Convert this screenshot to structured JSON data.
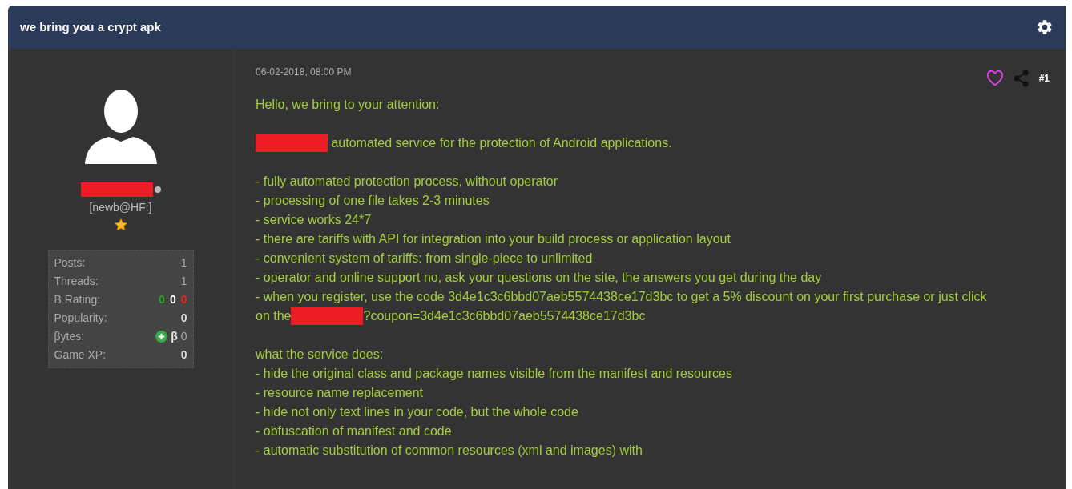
{
  "thread": {
    "title": "we bring you a crypt apk"
  },
  "author": {
    "online": false,
    "group": "[newb@HF:]",
    "stats": [
      {
        "kind": "plain",
        "label": "Posts:",
        "value": "1"
      },
      {
        "kind": "plain",
        "label": "Threads:",
        "value": "1"
      },
      {
        "kind": "rating",
        "label": "B Rating:",
        "values": [
          {
            "text": "0",
            "color": "#22aa22"
          },
          {
            "text": "0",
            "color": "#ffffff"
          },
          {
            "text": "0",
            "color": "#ee2222"
          }
        ]
      },
      {
        "kind": "bold",
        "label": "Popularity:",
        "value": "0"
      },
      {
        "kind": "bytes",
        "label": "βytes:",
        "symbol": "β",
        "value": "0"
      },
      {
        "kind": "bold",
        "label": "Game XP:",
        "value": "0"
      }
    ]
  },
  "post": {
    "date": "06-02-2018, 08:00 PM",
    "liked": false,
    "number": "#1",
    "blocks": [
      [
        {
          "parts": [
            {
              "kind": "text",
              "text": "Hello, we bring to your attention:"
            }
          ]
        }
      ],
      [
        {
          "parts": [
            {
              "kind": "redaction"
            },
            {
              "kind": "text",
              "text": " automated service for the protection of Android applications."
            }
          ]
        }
      ],
      [
        {
          "parts": [
            {
              "kind": "text",
              "text": "- fully automated protection process, without operator"
            }
          ]
        },
        {
          "parts": [
            {
              "kind": "text",
              "text": "- processing of one file takes 2-3 minutes"
            }
          ]
        },
        {
          "parts": [
            {
              "kind": "text",
              "text": "- service works 24*7"
            }
          ]
        },
        {
          "parts": [
            {
              "kind": "text",
              "text": "- there are tariffs with API for integration into your build process or application layout"
            }
          ]
        },
        {
          "parts": [
            {
              "kind": "text",
              "text": "- convenient system of tariffs: from single-piece to unlimited"
            }
          ]
        },
        {
          "parts": [
            {
              "kind": "text",
              "text": "- operator and online support no, ask your questions on the site, the answers you get during the day"
            }
          ]
        },
        {
          "parts": [
            {
              "kind": "text",
              "text": "- when you register, use the code 3d4e1c3c6bbd07aeb5574438ce17d3bc to get a 5% discount on your first purchase or just click"
            }
          ]
        },
        {
          "parts": [
            {
              "kind": "text",
              "text": "on the"
            },
            {
              "kind": "redaction"
            },
            {
              "kind": "text",
              "text": "?coupon=3d4e1c3c6bbd07aeb5574438ce17d3bc"
            }
          ]
        }
      ],
      [
        {
          "parts": [
            {
              "kind": "text",
              "text": "what the service does:"
            }
          ]
        },
        {
          "parts": [
            {
              "kind": "text",
              "text": "- hide the original class and package names visible from the manifest and resources"
            }
          ]
        },
        {
          "parts": [
            {
              "kind": "text",
              "text": "- resource name replacement"
            }
          ]
        },
        {
          "parts": [
            {
              "kind": "text",
              "text": "- hide not only text lines in your code, but the whole code"
            }
          ]
        },
        {
          "parts": [
            {
              "kind": "text",
              "text": "- obfuscation of manifest and code"
            }
          ]
        },
        {
          "parts": [
            {
              "kind": "text",
              "text": "- automatic substitution of common resources (xml and images) with"
            }
          ]
        }
      ]
    ]
  }
}
